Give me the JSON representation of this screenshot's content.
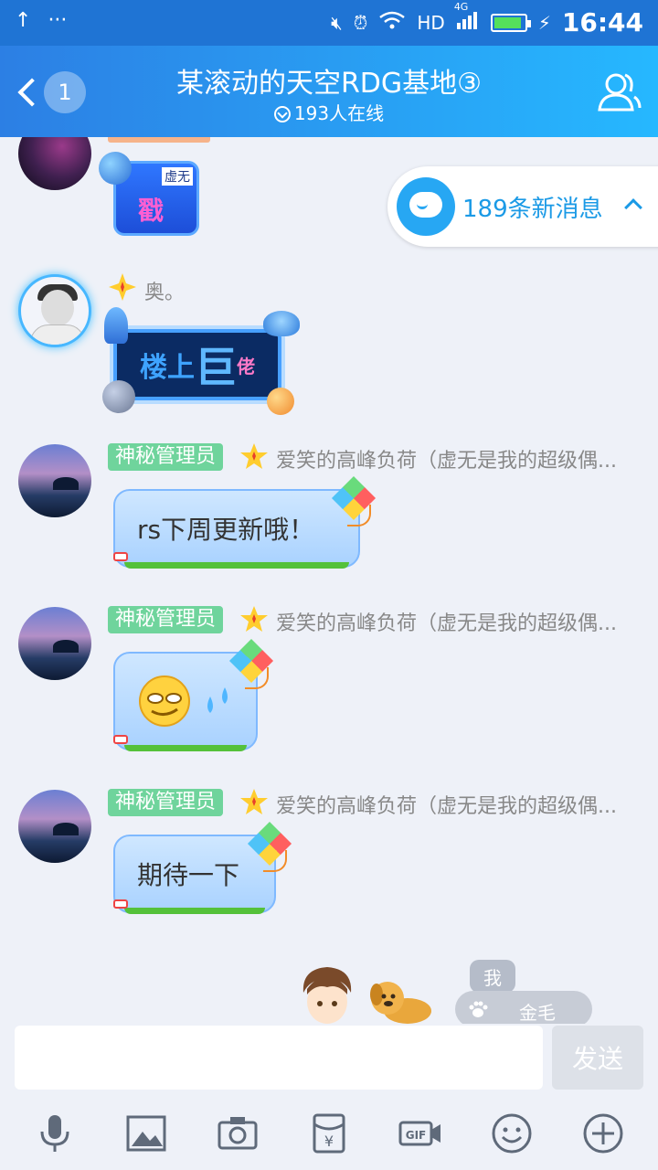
{
  "status_bar": {
    "time": "16:44",
    "network": "HD",
    "network_type": "4G",
    "notif_dots": "···"
  },
  "header": {
    "badge_count": "1",
    "title": "某滚动的天空RDG基地③",
    "online": "193人在线"
  },
  "new_messages": {
    "label": "189条新消息"
  },
  "stickers": {
    "small_tag": "虚无",
    "small_glyph": "戳",
    "big_text_a": "楼上",
    "big_text_b": "巨",
    "big_text_c": "佬"
  },
  "messages": [
    {
      "role": "",
      "sender": "奥。",
      "text": ""
    },
    {
      "role": "神秘管理员",
      "sender": "爱笑的高峰负荷（虚无是我的超级偶...",
      "text": "rs下周更新哦！"
    },
    {
      "role": "神秘管理员",
      "sender": "爱笑的高峰负荷（虚无是我的超级偶...",
      "text": ""
    },
    {
      "role": "神秘管理员",
      "sender": "爱笑的高峰负荷（虚无是我的超级偶...",
      "text": "期待一下"
    }
  ],
  "me_tag": "我",
  "pet_name": "金毛",
  "input": {
    "value": "",
    "placeholder": ""
  },
  "send_label": "发送",
  "colors": {
    "header_start": "#2c7fe4",
    "header_end": "#26b8ff",
    "role_badge": "#6fd49c",
    "accent": "#1b9ae6"
  },
  "toolbar_icons": [
    "mic-icon",
    "image-icon",
    "camera-icon",
    "red-packet-icon",
    "gif-icon",
    "emoji-icon",
    "plus-icon"
  ]
}
